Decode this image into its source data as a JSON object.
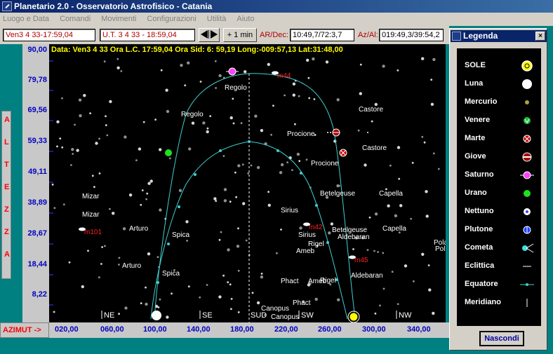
{
  "window": {
    "title": "Planetario 2.0 - Osservatorio Astrofisico - Catania"
  },
  "menu": [
    "Luogo e Data",
    "Comandi",
    "Movimenti",
    "Configurazioni",
    "Utilità",
    "Aiuto"
  ],
  "toolbar": {
    "local_time": "Ven3 4 33-17:59,04",
    "ut_time": "U.T. 3 4 33 - 18:59,04",
    "step_button": "+ 1 min",
    "ardec_label": "AR/Dec:",
    "ardec_value": "10:49,7/72:3,7",
    "azal_label": "Az/Al:",
    "azal_value": "019:49,3/39:54,2"
  },
  "sky": {
    "data_line": "Data: Ven3 4 33 Ora L.C. 17:59,04 Ora Sid: 6: 59,19 Long:-009:57,13 Lat:31:48,00",
    "labels": [
      "Regolo",
      "Regolo",
      "Castore",
      "Castore",
      "Procione",
      "Procione",
      "Betelgeuse",
      "Betelgeuse",
      "Capella",
      "Capella",
      "Mizar",
      "Mizar",
      "Sirius",
      "Sirius",
      "Arturo",
      "Arturo",
      "Spica",
      "Spica",
      "Aldebaran",
      "Aldebaran",
      "Rigel",
      "Rigel",
      "Ameb",
      "Ameb",
      "Phact",
      "Phact",
      "Canopus",
      "Canopus",
      "Pola",
      "Pol"
    ],
    "messier": [
      "m44",
      "m42",
      "m101",
      "m45"
    ],
    "compass": [
      "NE",
      "SE",
      "SUD",
      "SW",
      "NW"
    ]
  },
  "altitude_axis": {
    "title_letters": [
      "A",
      "L",
      "T",
      "E",
      "Z",
      "Z",
      "A"
    ],
    "ticks": [
      "90,00",
      "79,78",
      "69,56",
      "59,33",
      "49,11",
      "38,89",
      "28,67",
      "18,44",
      "8,22"
    ]
  },
  "azimuth_axis": {
    "button": "AZIMUT ->",
    "ticks": [
      "020,00",
      "060,00",
      "100,00",
      "140,00",
      "180,00",
      "220,00",
      "260,00",
      "300,00",
      "340,00"
    ]
  },
  "legend": {
    "title": "Legenda",
    "items": [
      {
        "label": "SOLE",
        "icon": "sun-icon"
      },
      {
        "label": "Luna",
        "icon": "moon-icon"
      },
      {
        "label": "Mercurio",
        "icon": "mercury-icon"
      },
      {
        "label": "Venere",
        "icon": "venus-icon"
      },
      {
        "label": "Marte",
        "icon": "mars-icon"
      },
      {
        "label": "Giove",
        "icon": "jupiter-icon"
      },
      {
        "label": "Saturno",
        "icon": "saturn-icon"
      },
      {
        "label": "Urano",
        "icon": "uranus-icon"
      },
      {
        "label": "Nettuno",
        "icon": "neptune-icon"
      },
      {
        "label": "Plutone",
        "icon": "pluto-icon"
      },
      {
        "label": "Cometa",
        "icon": "comet-icon"
      },
      {
        "label": "Eclittica",
        "icon": "ecliptic-icon"
      },
      {
        "label": "Equatore",
        "icon": "equator-icon"
      },
      {
        "label": "Meridiano",
        "icon": "meridian-icon"
      }
    ],
    "hide_button": "Nascondi"
  },
  "colors": {
    "sky": "#000000",
    "title_bar": "#0a246a",
    "axis_text": "#0000c0",
    "star_label": "#ffffff",
    "messier_label": "#ff2020",
    "curve": "#40d0d0",
    "data_text": "#ffff00"
  }
}
